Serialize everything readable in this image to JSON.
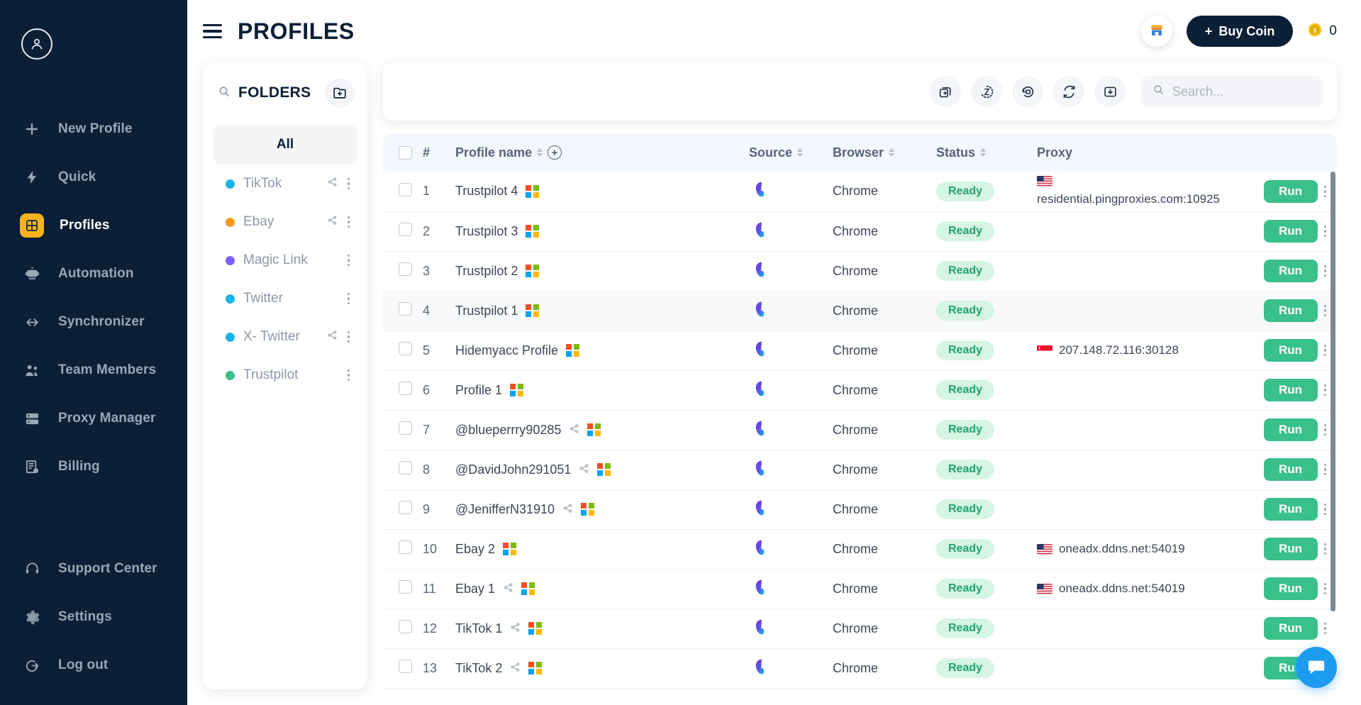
{
  "sidebar": {
    "avatar": "user-avatar",
    "items": [
      {
        "label": "New Profile",
        "icon": "plus-icon",
        "active": false
      },
      {
        "label": "Quick",
        "icon": "lightning-icon",
        "active": false
      },
      {
        "label": "Profiles",
        "icon": "grid-icon",
        "active": true
      },
      {
        "label": "Automation",
        "icon": "robot-icon",
        "active": false
      },
      {
        "label": "Synchronizer",
        "icon": "sync-icon",
        "active": false
      },
      {
        "label": "Team Members",
        "icon": "team-icon",
        "active": false
      },
      {
        "label": "Proxy Manager",
        "icon": "server-icon",
        "active": false
      },
      {
        "label": "Billing",
        "icon": "invoice-icon",
        "active": false
      }
    ],
    "bottom_items": [
      {
        "label": "Support Center",
        "icon": "headset-icon"
      },
      {
        "label": "Settings",
        "icon": "gear-icon"
      },
      {
        "label": "Log out",
        "icon": "logout-icon"
      }
    ],
    "colors": {
      "bg": "#0b1f36",
      "active_accent": "#f5b31d",
      "muted": "#9aa7b5"
    }
  },
  "header": {
    "title": "PROFILES",
    "menu_icon": "hamburger-icon",
    "store_icon": "store-icon",
    "buy_coin_label": "Buy Coin",
    "buy_coin_plus": "+",
    "coin_icon": "coin-icon",
    "coin_balance": "0"
  },
  "folders": {
    "title": "FOLDERS",
    "search_icon": "search-icon",
    "add_icon": "add-folder-icon",
    "all_label": "All",
    "items": [
      {
        "label": "TikTok",
        "color": "#1bb3e8",
        "has_share": true
      },
      {
        "label": "Ebay",
        "color": "#f59a23",
        "has_share": true
      },
      {
        "label": "Magic Link",
        "color": "#7b61ff",
        "has_share": false
      },
      {
        "label": "Twitter",
        "color": "#1bb3e8",
        "has_share": false
      },
      {
        "label": "X- Twitter",
        "color": "#1bb3e8",
        "has_share": true
      },
      {
        "label": "Trustpilot",
        "color": "#3ac08a",
        "has_share": false
      }
    ]
  },
  "toolbar": {
    "buttons": [
      {
        "name": "duplicate-profile-icon"
      },
      {
        "name": "history-icon"
      },
      {
        "name": "restore-icon"
      },
      {
        "name": "refresh-icon"
      },
      {
        "name": "export-icon"
      }
    ],
    "search_placeholder": "Search...",
    "search_value": ""
  },
  "table": {
    "columns": [
      {
        "key": "checkbox",
        "label": "",
        "sortable": false
      },
      {
        "key": "index",
        "label": "#",
        "sortable": false
      },
      {
        "key": "name",
        "label": "Profile name",
        "sortable": true,
        "has_add": true
      },
      {
        "key": "source",
        "label": "Source",
        "sortable": true
      },
      {
        "key": "browser",
        "label": "Browser",
        "sortable": true
      },
      {
        "key": "status",
        "label": "Status",
        "sortable": true
      },
      {
        "key": "proxy",
        "label": "Proxy",
        "sortable": false
      },
      {
        "key": "actions",
        "label": "",
        "sortable": false
      }
    ],
    "run_label": "Run",
    "rows": [
      {
        "index": "1",
        "name": "Trustpilot 4",
        "share": false,
        "source": "firefox-icon",
        "browser": "Chrome",
        "status": "Ready",
        "proxy": "residential.pingproxies.com:10925",
        "flag": "us",
        "proxy_stacked": true,
        "highlight": false
      },
      {
        "index": "2",
        "name": "Trustpilot 3",
        "share": false,
        "source": "firefox-icon",
        "browser": "Chrome",
        "status": "Ready",
        "proxy": "",
        "flag": "",
        "proxy_stacked": false,
        "highlight": false
      },
      {
        "index": "3",
        "name": "Trustpilot 2",
        "share": false,
        "source": "firefox-icon",
        "browser": "Chrome",
        "status": "Ready",
        "proxy": "",
        "flag": "",
        "proxy_stacked": false,
        "highlight": false
      },
      {
        "index": "4",
        "name": "Trustpilot 1",
        "share": false,
        "source": "firefox-icon",
        "browser": "Chrome",
        "status": "Ready",
        "proxy": "",
        "flag": "",
        "proxy_stacked": false,
        "highlight": true
      },
      {
        "index": "5",
        "name": "Hidemyacc Profile",
        "share": false,
        "source": "firefox-icon",
        "browser": "Chrome",
        "status": "Ready",
        "proxy": "207.148.72.116:30128",
        "flag": "sg",
        "proxy_stacked": false,
        "highlight": false
      },
      {
        "index": "6",
        "name": "Profile 1",
        "share": false,
        "source": "firefox-icon",
        "browser": "Chrome",
        "status": "Ready",
        "proxy": "",
        "flag": "",
        "proxy_stacked": false,
        "highlight": false
      },
      {
        "index": "7",
        "name": "@blueperrry90285",
        "share": true,
        "source": "firefox-icon",
        "browser": "Chrome",
        "status": "Ready",
        "proxy": "",
        "flag": "",
        "proxy_stacked": false,
        "highlight": false
      },
      {
        "index": "8",
        "name": "@DavidJohn291051",
        "share": true,
        "source": "firefox-icon",
        "browser": "Chrome",
        "status": "Ready",
        "proxy": "",
        "flag": "",
        "proxy_stacked": false,
        "highlight": false
      },
      {
        "index": "9",
        "name": "@JenifferN31910",
        "share": true,
        "source": "firefox-icon",
        "browser": "Chrome",
        "status": "Ready",
        "proxy": "",
        "flag": "",
        "proxy_stacked": false,
        "highlight": false
      },
      {
        "index": "10",
        "name": "Ebay 2",
        "share": false,
        "source": "firefox-icon",
        "browser": "Chrome",
        "status": "Ready",
        "proxy": "oneadx.ddns.net:54019",
        "flag": "us",
        "proxy_stacked": false,
        "highlight": false
      },
      {
        "index": "11",
        "name": "Ebay 1",
        "share": true,
        "source": "firefox-icon",
        "browser": "Chrome",
        "status": "Ready",
        "proxy": "oneadx.ddns.net:54019",
        "flag": "us",
        "proxy_stacked": false,
        "highlight": false
      },
      {
        "index": "12",
        "name": "TikTok 1",
        "share": true,
        "source": "firefox-icon",
        "browser": "Chrome",
        "status": "Ready",
        "proxy": "",
        "flag": "",
        "proxy_stacked": false,
        "highlight": false
      },
      {
        "index": "13",
        "name": "TikTok 2",
        "share": true,
        "source": "firefox-icon",
        "browser": "Chrome",
        "status": "Ready",
        "proxy": "",
        "flag": "",
        "proxy_stacked": false,
        "highlight": false
      }
    ]
  },
  "chat": {
    "icon": "chat-icon",
    "color": "#1d9bf0"
  },
  "colors": {
    "status_bg": "#d6f5e3",
    "status_text": "#21a366",
    "run_green": "#3ac08a",
    "header_row": "#f2f8fe"
  }
}
